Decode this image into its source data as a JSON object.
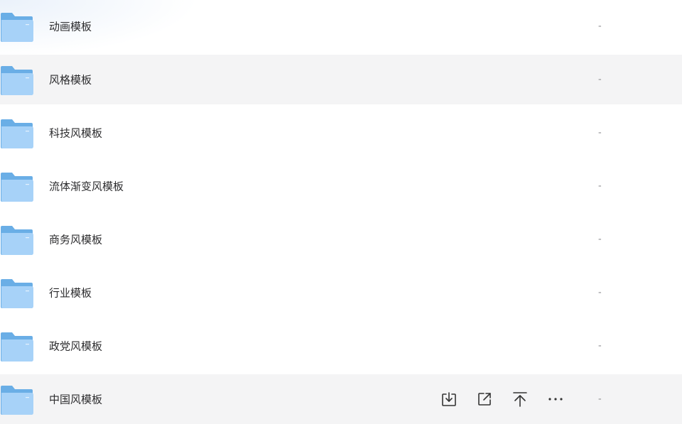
{
  "folders": [
    {
      "name": "动画模板",
      "size": "-"
    },
    {
      "name": "风格模板",
      "size": "-"
    },
    {
      "name": "科技风模板",
      "size": "-"
    },
    {
      "name": "流体渐变风模板",
      "size": "-"
    },
    {
      "name": "商务风模板",
      "size": "-"
    },
    {
      "name": "行业模板",
      "size": "-"
    },
    {
      "name": "政党风模板",
      "size": "-"
    },
    {
      "name": "中国风模板",
      "size": "-"
    }
  ],
  "row_actions": [
    "download-icon",
    "share-icon",
    "pin-top-icon",
    "more-icon"
  ],
  "colors": {
    "folder_back": "#6aaee6",
    "folder_front": "#a7d2f8",
    "row_highlight": "#f4f4f5",
    "text": "#2c2c2e",
    "muted": "#8b8b8f",
    "icon": "#333333"
  }
}
